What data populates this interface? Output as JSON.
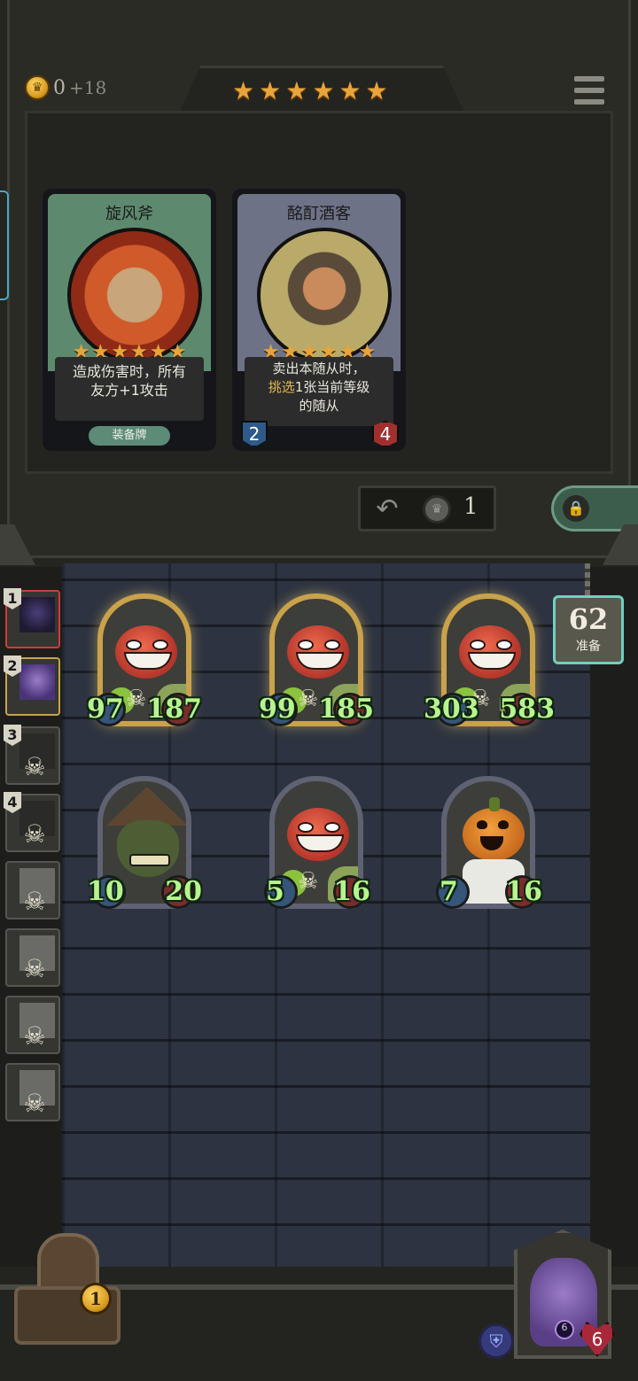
{
  "economy": {
    "gold": "0",
    "income": "+18"
  },
  "tavern_tier_stars": 6,
  "shop": {
    "cards": [
      {
        "name": "旋风斧",
        "stars": 6,
        "desc_lines": [
          "造成伤害时，所有",
          "友方+1攻击"
        ],
        "tag": "装备牌",
        "frame_color": "#5d8a6e"
      },
      {
        "name": "酩酊酒客",
        "stars": 6,
        "desc_line1": "卖出本随从时，",
        "desc_highlight": "挑选",
        "desc_line2_rest": "1张当前等级",
        "desc_line3": "的随从",
        "attack": "2",
        "health": "4",
        "frame_color": "#6e7287"
      }
    ],
    "refresh_cost": "1"
  },
  "timer": {
    "value": "62",
    "label": "准备"
  },
  "players": [
    {
      "rank": "1",
      "state": "active"
    },
    {
      "rank": "2",
      "state": "active"
    },
    {
      "rank": "3",
      "state": "dead"
    },
    {
      "rank": "4",
      "state": "dead"
    },
    {
      "rank": "",
      "state": "dead"
    },
    {
      "rank": "",
      "state": "dead"
    },
    {
      "rank": "",
      "state": "dead"
    },
    {
      "rank": "",
      "state": "dead"
    }
  ],
  "board": {
    "row1": [
      {
        "attack": "97",
        "health": "187",
        "type": "devil",
        "golden": true
      },
      {
        "attack": "99",
        "health": "185",
        "type": "devil",
        "golden": true
      },
      {
        "attack": "303",
        "health": "583",
        "type": "devil",
        "golden": true
      }
    ],
    "row2": [
      {
        "attack": "10",
        "health": "20",
        "type": "goblin",
        "golden": false
      },
      {
        "attack": "5",
        "health": "16",
        "type": "devil",
        "golden": false
      },
      {
        "attack": "7",
        "health": "16",
        "type": "pumpkin",
        "golden": false
      }
    ]
  },
  "chest": {
    "count": "1"
  },
  "hero": {
    "health": "6",
    "orb": "6"
  },
  "colors": {
    "star": "#e9a43a",
    "stat_green": "#b6f58e",
    "timer_border": "#6fd0c0",
    "player1_highlight": "#d23a3a",
    "player2_highlight": "#c9a24a"
  }
}
